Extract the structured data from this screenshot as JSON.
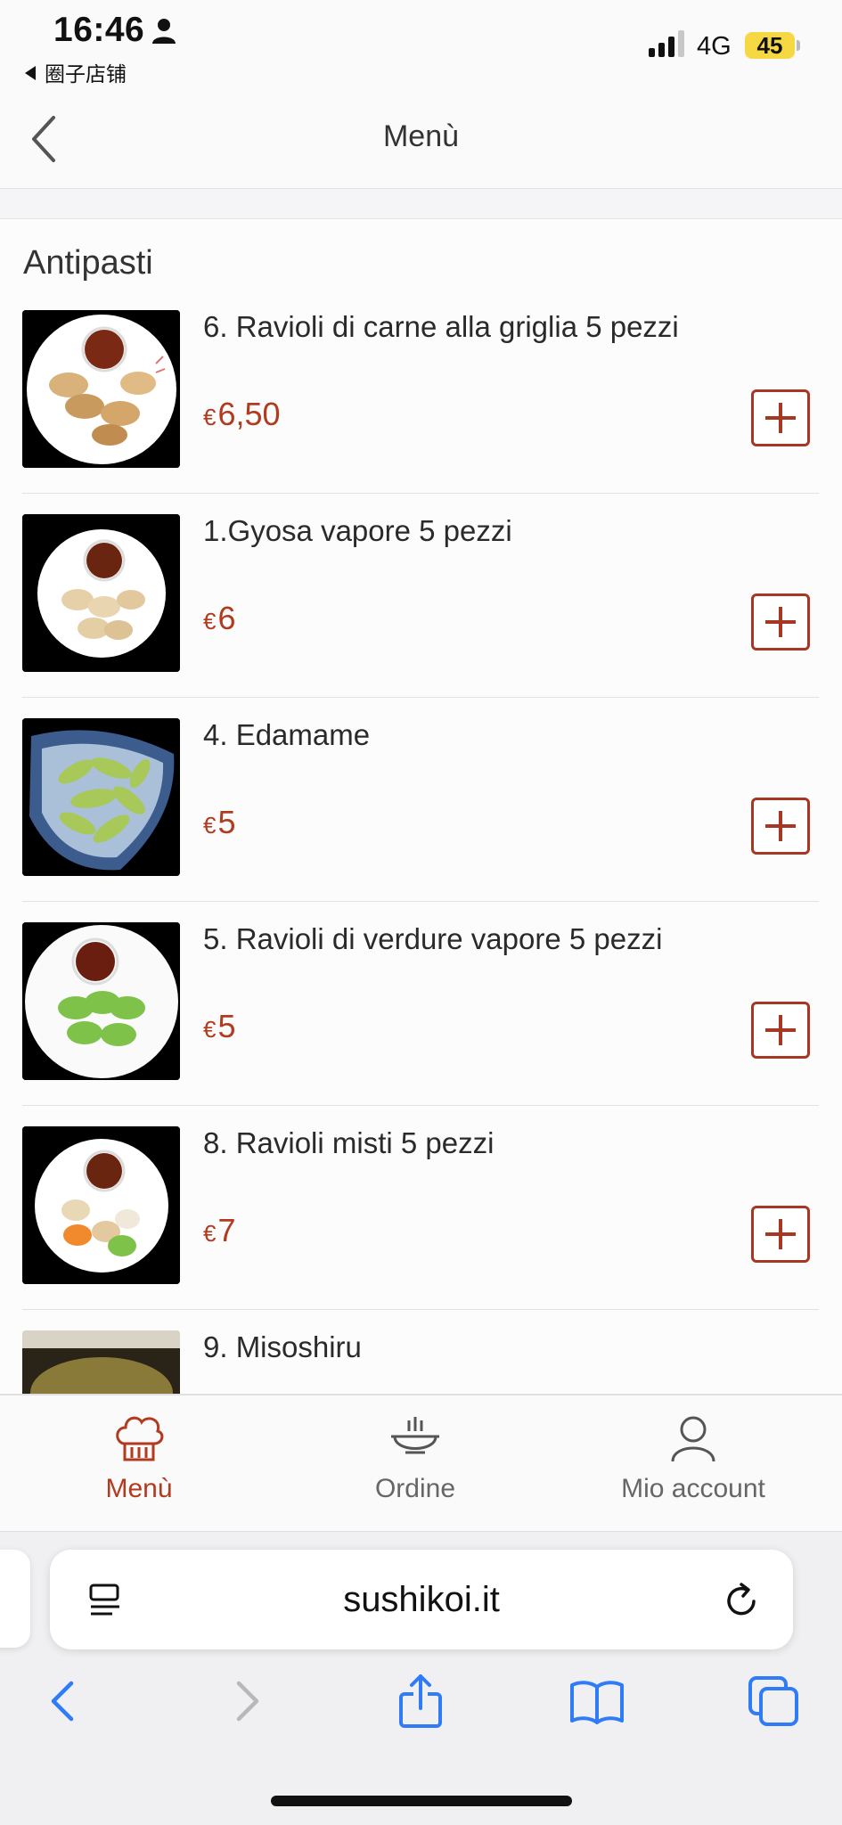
{
  "status_bar": {
    "time": "16:46",
    "back_app": "圈子店铺",
    "network": "4G",
    "battery": "45"
  },
  "header": {
    "title": "Menù"
  },
  "section": {
    "title": "Antipasti"
  },
  "items": [
    {
      "name": "6. Ravioli di carne alla griglia 5 pezzi",
      "currency": "€",
      "price": "6,50"
    },
    {
      "name": "1.Gyosa vapore 5 pezzi",
      "currency": "€",
      "price": "6"
    },
    {
      "name": "4. Edamame",
      "currency": "€",
      "price": "5"
    },
    {
      "name": "5. Ravioli di verdure vapore 5 pezzi",
      "currency": "€",
      "price": "5"
    },
    {
      "name": "8. Ravioli misti 5 pezzi",
      "currency": "€",
      "price": "7"
    },
    {
      "name": "9. Misoshiru",
      "currency": "",
      "price": ""
    }
  ],
  "tabbar": {
    "tabs": [
      {
        "label": "Menù",
        "icon": "chef-hat-icon",
        "active": true
      },
      {
        "label": "Ordine",
        "icon": "bowl-icon",
        "active": false
      },
      {
        "label": "Mio account",
        "icon": "user-icon",
        "active": false
      }
    ]
  },
  "browser": {
    "url": "sushikoi.it"
  },
  "colors": {
    "accent": "#b23a1f",
    "battery": "#f5d842",
    "safari_blue": "#2f7cf6"
  }
}
